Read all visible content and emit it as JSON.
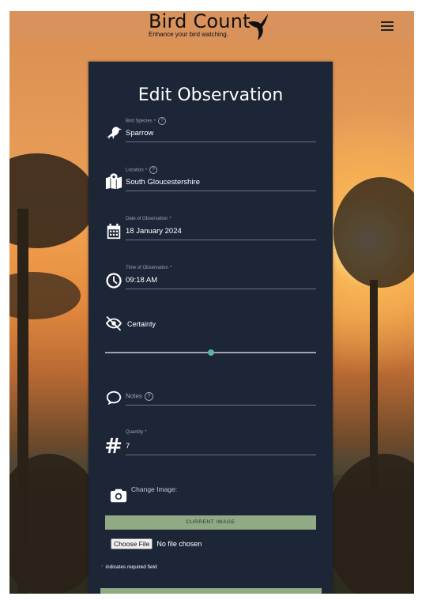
{
  "header": {
    "title": "Bird Count",
    "tagline": "Enhance your bird watching."
  },
  "form": {
    "title": "Edit Observation",
    "species": {
      "label": "Bird Species",
      "required_mark": "*",
      "value": "Sparrow",
      "help": "?"
    },
    "location": {
      "label": "Location",
      "required_mark": "*",
      "value": "South Gloucestershire",
      "help": "?"
    },
    "date": {
      "label": "Date of Observation",
      "required_mark": "*",
      "value": "18 January 2024"
    },
    "time": {
      "label": "Time of Observation",
      "required_mark": "*",
      "value": "09:18 AM"
    },
    "certainty": {
      "label": "Certainty",
      "level": 0.5
    },
    "notes": {
      "label": "Notes",
      "help": "?"
    },
    "quantity": {
      "label": "Quantity",
      "required_mark": "*",
      "value": "7"
    },
    "image": {
      "change_label": "Change Image:",
      "current_image_button": "CURRENT IMAGE",
      "choose_file_button": "Choose File",
      "no_file_text": "No file chosen"
    },
    "required_note": "indicates required field",
    "required_star": "*"
  },
  "colors": {
    "card": "#1d2637",
    "accent_button": "#91a984",
    "slider_thumb": "#59b5a1",
    "header_bg": "#d9925b"
  },
  "icons": [
    "bird-icon",
    "map-icon",
    "calendar-icon",
    "clock-icon",
    "eye-slash-icon",
    "comment-icon",
    "hash-icon",
    "camera-icon",
    "menu-icon"
  ]
}
